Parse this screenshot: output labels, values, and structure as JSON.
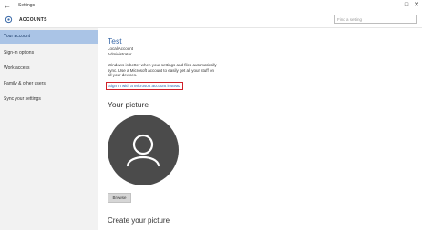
{
  "window": {
    "app_title": "Settings",
    "minimize_glyph": "–",
    "maximize_glyph": "□",
    "close_glyph": "✕",
    "back_glyph": "←"
  },
  "header": {
    "section_title": "ACCOUNTS",
    "search_placeholder": "Find a setting",
    "icon": "gear-icon"
  },
  "sidebar": {
    "items": [
      {
        "label": "Your account",
        "active": true
      },
      {
        "label": "Sign-in options",
        "active": false
      },
      {
        "label": "Work access",
        "active": false
      },
      {
        "label": "Family & other users",
        "active": false
      },
      {
        "label": "Sync your settings",
        "active": false
      }
    ]
  },
  "account": {
    "name": "Test",
    "type": "Local Account",
    "role": "Administrator",
    "description": "Windows is better when your settings and files automatically sync. Use a Microsoft account to easily get all your stuff on all your devices.",
    "ms_link": "Sign in with a Microsoft account instead"
  },
  "picture": {
    "heading": "Your picture",
    "browse_label": "Browse",
    "avatar_icon": "user-silhouette-icon"
  },
  "create": {
    "heading": "Create your picture"
  },
  "colors": {
    "accent": "#3b6aa8",
    "active_nav": "#aac4e6",
    "highlight_border": "#d0212a",
    "avatar_bg": "#4b4b4b"
  }
}
